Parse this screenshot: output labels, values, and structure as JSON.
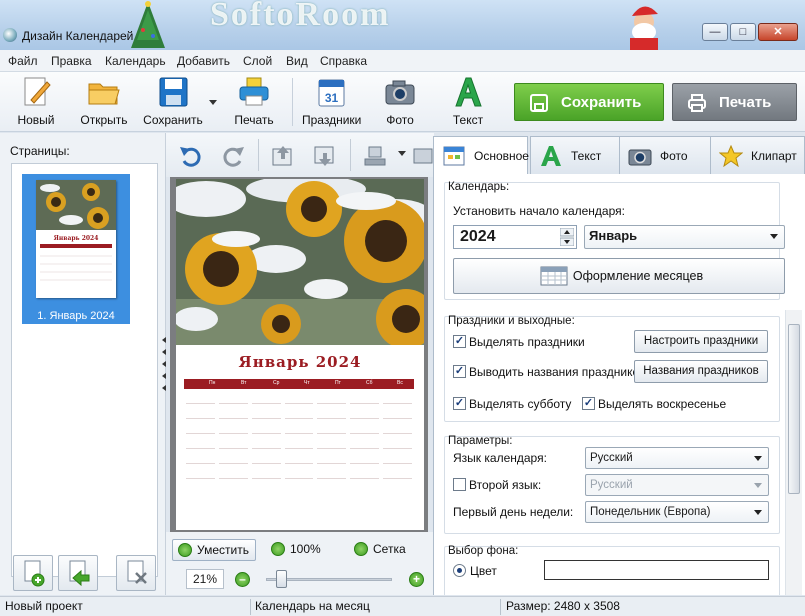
{
  "window": {
    "title": "Дизайн Календарей",
    "watermark": "SoftoRoom"
  },
  "menu": [
    "Файл",
    "Правка",
    "Календарь",
    "Добавить",
    "Слой",
    "Вид",
    "Справка"
  ],
  "toolbar": {
    "new": "Новый",
    "open": "Открыть",
    "save": "Сохранить",
    "print": "Печать",
    "holidays": "Праздники",
    "photo": "Фото",
    "text": "Текст",
    "save_big": "Сохранить",
    "print_big": "Печать",
    "save_color": "#58b132",
    "print_color": "#80868d"
  },
  "pages": {
    "label": "Страницы:",
    "items": [
      {
        "caption": "1. Январь 2024",
        "thumb_title": "Январь 2024"
      }
    ]
  },
  "calendar_page": {
    "title": "Январь 2024",
    "weekdays": [
      "Пн",
      "Вт",
      "Ср",
      "Чт",
      "Пт",
      "Сб",
      "Вс"
    ],
    "accent": "#9b1c22"
  },
  "zoom": {
    "fit": "Уместить",
    "hundred": "100%",
    "grid": "Сетка",
    "value": "21%",
    "slider_fraction": 0.1
  },
  "tabs": [
    {
      "label": "Основное",
      "active": true
    },
    {
      "label": "Текст",
      "active": false
    },
    {
      "label": "Фото",
      "active": false
    },
    {
      "label": "Клипарт",
      "active": false
    }
  ],
  "calendar_group": {
    "title": "Календарь:",
    "start_label": "Установить начало календаря:",
    "year": "2024",
    "month": "Январь",
    "months_button": "Оформление месяцев"
  },
  "holidays_group": {
    "title": "Праздники и выходные:",
    "highlight_holidays": "Выделять праздники",
    "configure_button": "Настроить праздники",
    "show_names": "Выводить названия праздников",
    "names_button": "Названия праздников",
    "highlight_saturday": "Выделять субботу",
    "highlight_sunday": "Выделять воскресенье"
  },
  "params_group": {
    "title": "Параметры:",
    "language_label": "Язык календаря:",
    "language_value": "Русский",
    "second_language_label": "Второй язык:",
    "second_language_value": "Русский",
    "first_day_label": "Первый день недели:",
    "first_day_value": "Понедельник (Европа)"
  },
  "background_group": {
    "title": "Выбор фона:",
    "color_option": "Цвет"
  },
  "status": {
    "project": "Новый проект",
    "type": "Календарь на месяц",
    "size": "Размер: 2480 x 3508"
  }
}
